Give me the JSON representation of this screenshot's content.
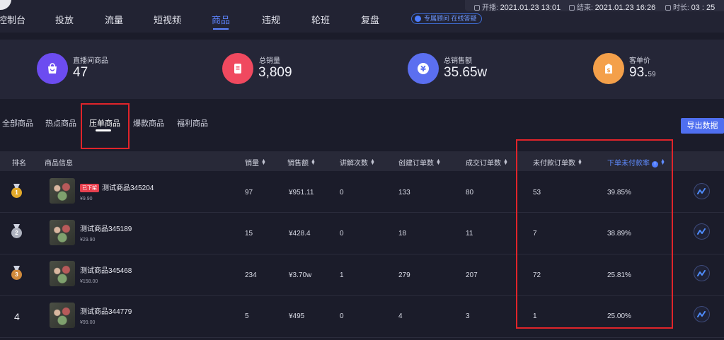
{
  "nav": {
    "items": [
      "控制台",
      "投放",
      "流量",
      "短视频",
      "商品",
      "违规",
      "轮班",
      "复盘"
    ],
    "active_index": 4,
    "consult_label": "专属顾问 在线答疑"
  },
  "session": {
    "start_label": "开播:",
    "start_value": "2021.01.23 13:01",
    "end_label": "结束:",
    "end_value": "2021.01.23 16:26",
    "duration_label": "时长:",
    "duration_value": "03 : 25"
  },
  "stats": [
    {
      "label": "直播间商品",
      "value": "47",
      "decimal": "",
      "icon": "shopping-bag-icon",
      "color": "#6c4cf0"
    },
    {
      "label": "总销量",
      "value": "3,809",
      "decimal": "",
      "icon": "document-icon",
      "color": "#f0495f"
    },
    {
      "label": "总销售额",
      "value": "35.65w",
      "decimal": "",
      "icon": "yen-icon",
      "color": "#5b6ff0"
    },
    {
      "label": "客单价",
      "value": "93.",
      "decimal": "59",
      "icon": "price-tag-icon",
      "color": "#f4a04a"
    }
  ],
  "tabs": {
    "items": [
      "全部商品",
      "热点商品",
      "压单商品",
      "爆款商品",
      "福利商品"
    ],
    "active_index": 2,
    "export_label": "导出数据"
  },
  "table": {
    "headers": {
      "rank": "排名",
      "info": "商品信息",
      "sales": "销量",
      "revenue": "销售额",
      "explains": "讲解次数",
      "created": "创建订单数",
      "paid": "成交订单数",
      "unpaid": "未付款订单数",
      "unpaid_rate": "下单未付款率"
    },
    "rows": [
      {
        "rank": "1",
        "badge": "已下架",
        "name": "测试商品345204",
        "price": "¥9.90",
        "sales": "97",
        "revenue": "¥951.11",
        "explains": "0",
        "created": "133",
        "paid": "80",
        "unpaid": "53",
        "unpaid_rate": "39.85%"
      },
      {
        "rank": "2",
        "badge": "",
        "name": "测试商品345189",
        "price": "¥29.90",
        "sales": "15",
        "revenue": "¥428.4",
        "explains": "0",
        "created": "18",
        "paid": "11",
        "unpaid": "7",
        "unpaid_rate": "38.89%"
      },
      {
        "rank": "3",
        "badge": "",
        "name": "测试商品345468",
        "price": "¥158.00",
        "sales": "234",
        "revenue": "¥3.70w",
        "explains": "1",
        "created": "279",
        "paid": "207",
        "unpaid": "72",
        "unpaid_rate": "25.81%"
      },
      {
        "rank": "4",
        "badge": "",
        "name": "测试商品344779",
        "price": "¥99.00",
        "sales": "5",
        "revenue": "¥495",
        "explains": "0",
        "created": "4",
        "paid": "3",
        "unpaid": "1",
        "unpaid_rate": "25.00%"
      }
    ]
  },
  "colors": {
    "accent": "#5d84ff",
    "highlight_box": "#e0242a",
    "gold": "#e3a92a",
    "silver": "#aeb2bf",
    "bronze": "#d08a3c"
  }
}
